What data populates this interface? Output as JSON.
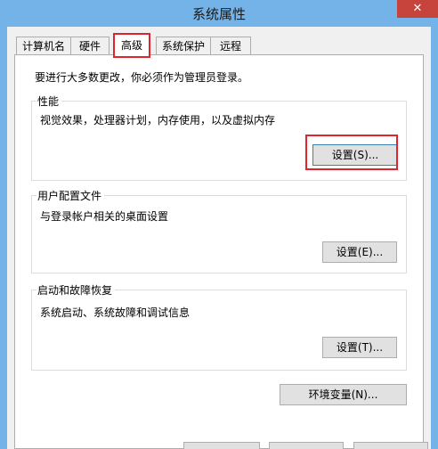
{
  "window": {
    "title": "系统属性",
    "close_glyph": "✕"
  },
  "tabs": [
    {
      "label": "计算机名",
      "active": false
    },
    {
      "label": "硬件",
      "active": false
    },
    {
      "label": "高级",
      "active": true
    },
    {
      "label": "系统保护",
      "active": false
    },
    {
      "label": "远程",
      "active": false
    }
  ],
  "advanced": {
    "admin_note": "要进行大多数更改，你必须作为管理员登录。",
    "performance": {
      "title": "性能",
      "description": "视觉效果，处理器计划，内存使用，以及虚拟内存",
      "button_label": "设置(S)..."
    },
    "user_profiles": {
      "title": "用户配置文件",
      "description": "与登录帐户相关的桌面设置",
      "button_label": "设置(E)..."
    },
    "startup_recovery": {
      "title": "启动和故障恢复",
      "description": "系统启动、系统故障和调试信息",
      "button_label": "设置(T)..."
    },
    "env_vars_label": "环境变量(N)..."
  },
  "colors": {
    "titlebar": "#74b3e8",
    "close_button": "#c7443c",
    "highlight": "#e0232d"
  }
}
